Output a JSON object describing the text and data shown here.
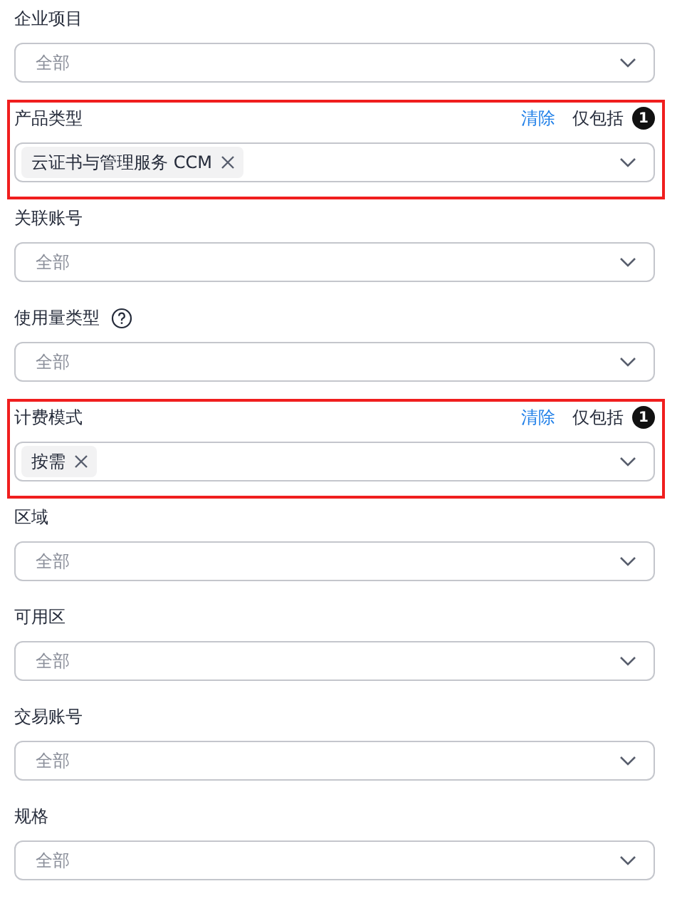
{
  "fields": [
    {
      "label": "企业项目",
      "help": false,
      "highlighted": false,
      "placeholder": "全部"
    },
    {
      "label": "产品类型",
      "help": false,
      "highlighted": true,
      "clear": "清除",
      "include": "仅包括",
      "count": "1",
      "tags": [
        "云证书与管理服务 CCM"
      ]
    },
    {
      "label": "关联账号",
      "help": false,
      "highlighted": false,
      "placeholder": "全部"
    },
    {
      "label": "使用量类型",
      "help": true,
      "highlighted": false,
      "placeholder": "全部"
    },
    {
      "label": "计费模式",
      "help": false,
      "highlighted": true,
      "clear": "清除",
      "include": "仅包括",
      "count": "1",
      "tags": [
        "按需"
      ]
    },
    {
      "label": "区域",
      "help": false,
      "highlighted": false,
      "placeholder": "全部"
    },
    {
      "label": "可用区",
      "help": false,
      "highlighted": false,
      "placeholder": "全部"
    },
    {
      "label": "交易账号",
      "help": false,
      "highlighted": false,
      "placeholder": "全部"
    },
    {
      "label": "规格",
      "help": false,
      "highlighted": false,
      "placeholder": "全部"
    }
  ]
}
